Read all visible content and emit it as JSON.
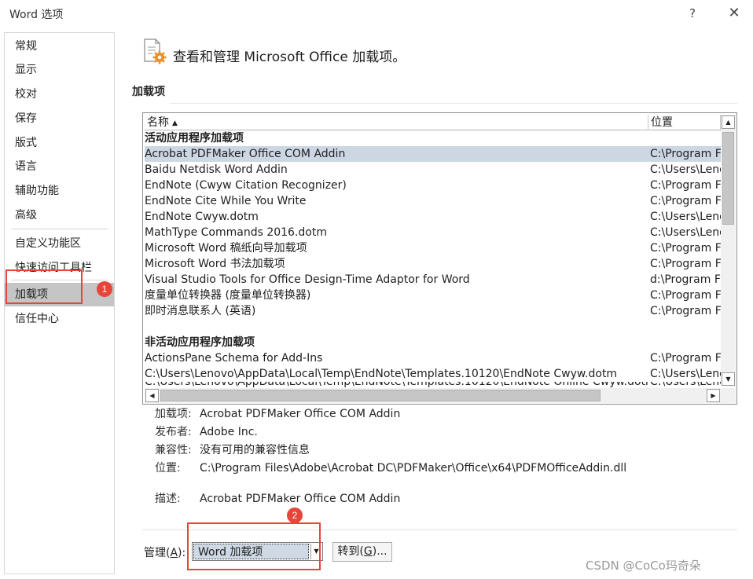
{
  "window": {
    "title": "Word 选项",
    "help_glyph": "?",
    "close_glyph": "✕"
  },
  "sidebar": {
    "items": [
      {
        "label": "常规"
      },
      {
        "label": "显示"
      },
      {
        "label": "校对"
      },
      {
        "label": "保存"
      },
      {
        "label": "版式"
      },
      {
        "label": "语言"
      },
      {
        "label": "辅助功能"
      },
      {
        "label": "高级"
      },
      {
        "label": "自定义功能区"
      },
      {
        "label": "快速访问工具栏"
      },
      {
        "label": "加载项",
        "selected": true
      },
      {
        "label": "信任中心"
      }
    ]
  },
  "annotations": {
    "badge1": "1",
    "badge2": "2",
    "color": "#e8443a"
  },
  "header": {
    "icon": "addin-gear-icon",
    "text": "查看和管理 Microsoft Office 加载项。"
  },
  "section": {
    "title": "加载项"
  },
  "table": {
    "columns": {
      "name": "名称",
      "location": "位置",
      "sort_indicator": "▲"
    },
    "active_group": "活动应用程序加载项",
    "inactive_group": "非活动应用程序加载项",
    "active_rows": [
      {
        "name": "Acrobat PDFMaker Office COM Addin",
        "location": "C:\\Program Fil",
        "selected": true
      },
      {
        "name": "Baidu Netdisk Word Addin",
        "location": "C:\\Users\\Leno"
      },
      {
        "name": "EndNote (Cwyw Citation Recognizer)",
        "location": "C:\\Program Fil"
      },
      {
        "name": "EndNote Cite While You Write",
        "location": "C:\\Program Fil"
      },
      {
        "name": "EndNote Cwyw.dotm",
        "location": "C:\\Users\\Leno"
      },
      {
        "name": "MathType Commands 2016.dotm",
        "location": "C:\\Users\\Leno"
      },
      {
        "name": "Microsoft Word 稿纸向导加载项",
        "location": "C:\\Program Fil"
      },
      {
        "name": "Microsoft Word 书法加载项",
        "location": "C:\\Program Fil"
      },
      {
        "name": "Visual Studio Tools for Office Design-Time Adaptor for Word",
        "location": "d:\\Program Fil"
      },
      {
        "name": "度量单位转换器 (度量单位转换器)",
        "location": "C:\\Program Fil"
      },
      {
        "name": "即时消息联系人 (英语)",
        "location": "C:\\Program Fil"
      }
    ],
    "inactive_rows": [
      {
        "name": "ActionsPane Schema for Add-Ins",
        "location": "C:\\Program Fil"
      },
      {
        "name": "C:\\Users\\Lenovo\\AppData\\Local\\Temp\\EndNote\\Templates.10120\\EndNote Cwyw.dotm",
        "location": "C:\\Users\\Leno"
      },
      {
        "name": "C:\\Users\\Lenovo\\AppData\\Local\\Temp\\EndNote\\Templates.10120\\EndNote Online Cwyw.dotm",
        "location": "C:\\Users\\Leno"
      }
    ]
  },
  "details": {
    "addin_label": "加载项:",
    "addin_value": "Acrobat PDFMaker Office COM Addin",
    "publisher_label": "发布者:",
    "publisher_value": "Adobe Inc.",
    "compat_label": "兼容性:",
    "compat_value": "没有可用的兼容性信息",
    "location_label": "位置:",
    "location_value": "C:\\Program Files\\Adobe\\Acrobat DC\\PDFMaker\\Office\\x64\\PDFMOfficeAddin.dll",
    "desc_label": "描述:",
    "desc_value": "Acrobat PDFMaker Office COM Addin"
  },
  "manage": {
    "label_prefix": "管理(",
    "label_key": "A",
    "label_suffix": "):",
    "selected_option": "Word 加载项",
    "goto_prefix": "转到(",
    "goto_key": "G",
    "goto_suffix": ")..."
  },
  "watermark": "CSDN @CoCo玛奇朵"
}
